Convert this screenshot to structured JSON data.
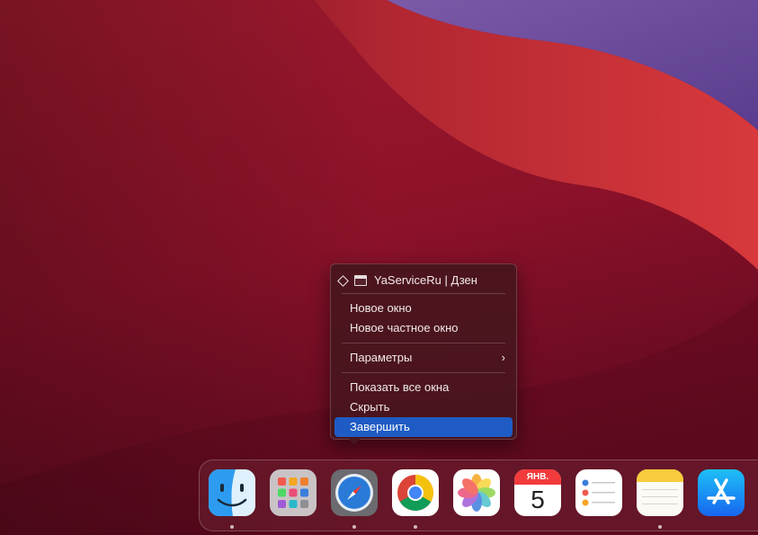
{
  "colors": {
    "menu_highlight": "#1f5bc4",
    "wallpaper_base": "#7a0f25",
    "wallpaper_accent": "#c8323a",
    "wallpaper_sky": "#6a4a98"
  },
  "context_menu": {
    "window_title": "YaServiceRu | Дзен",
    "items": {
      "new_window": "Новое окно",
      "new_private_window": "Новое частное окно",
      "settings": "Параметры",
      "settings_chevron": "›",
      "show_all_windows": "Показать все окна",
      "hide": "Скрыть",
      "quit": "Завершить"
    },
    "highlighted_item": "quit"
  },
  "dock": {
    "apps": [
      {
        "icon": "finder-icon",
        "running": true
      },
      {
        "icon": "launchpad-icon",
        "running": false
      },
      {
        "icon": "safari-icon",
        "running": true,
        "context_menu_open": true
      },
      {
        "icon": "chrome-icon",
        "running": true
      },
      {
        "icon": "photos-icon",
        "running": false
      },
      {
        "icon": "calendar-icon",
        "running": false
      },
      {
        "icon": "reminders-icon",
        "running": false
      },
      {
        "icon": "notes-icon",
        "running": true
      },
      {
        "icon": "app-store-icon",
        "running": false
      }
    ],
    "calendar": {
      "month": "ЯНВ.",
      "day": "5"
    }
  }
}
